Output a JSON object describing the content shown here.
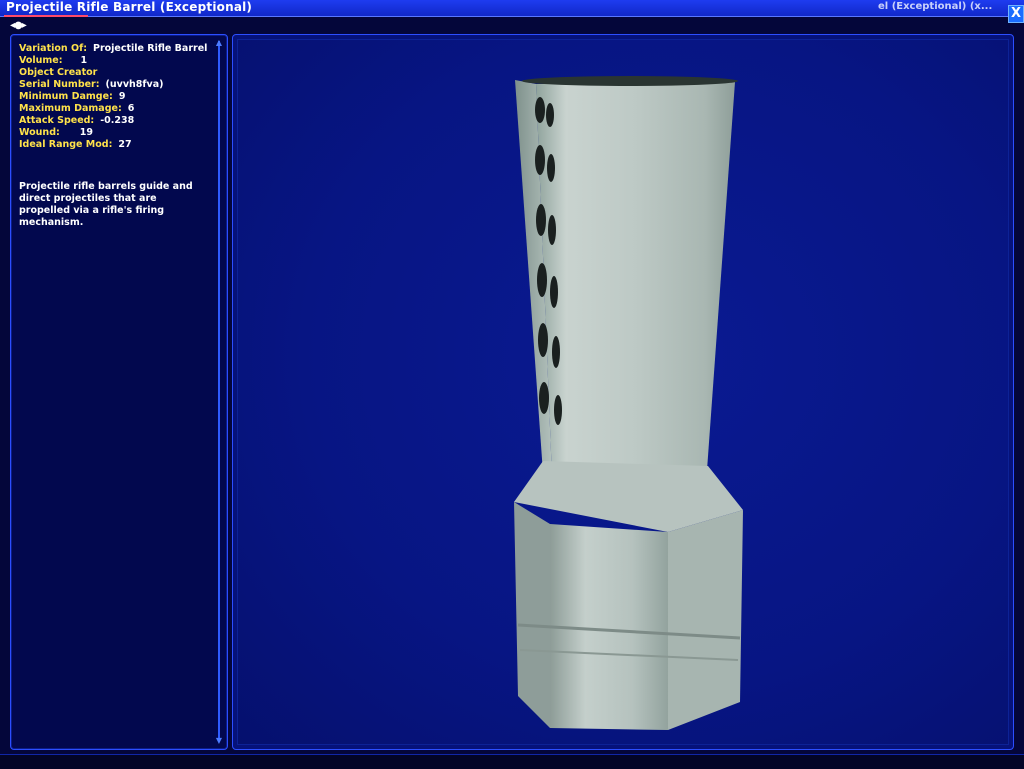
{
  "window": {
    "title": "Projectile Rifle Barrel (Exceptional)",
    "ghost_title": "el (Exceptional) (x...",
    "close_label": "X",
    "nav_label": "◂●▸"
  },
  "attributes": [
    {
      "key": "Variation Of:",
      "value": "Projectile Rifle Barrel"
    },
    {
      "key": "Volume:",
      "value": "1"
    },
    {
      "key": "Object Creator",
      "value": ""
    },
    {
      "key": "Serial Number:",
      "value": "(uvvh8fva)"
    },
    {
      "key": "Minimum Damge:",
      "value": "9"
    },
    {
      "key": "Maximum Damage:",
      "value": "6"
    },
    {
      "key": "Attack Speed:",
      "value": "-0.238"
    },
    {
      "key": "Wound:",
      "value": "19"
    },
    {
      "key": "Ideal Range Mod:",
      "value": "27"
    }
  ],
  "description": "Projectile rifle barrels guide and direct projectiles that are propelled via a rifle's firing mechanism.",
  "colors": {
    "title_bar": "#1128c8",
    "panel_bg": "#02084e",
    "viewer_bg": "#071583",
    "attr_key": "#ffe24a",
    "attr_val": "#ffffff",
    "metal": "#b8c4c0"
  },
  "icons": {
    "close": "close-icon",
    "nav": "nav-arrows-icon",
    "scroll_up": "scroll-up-icon",
    "scroll_down": "scroll-down-icon"
  }
}
